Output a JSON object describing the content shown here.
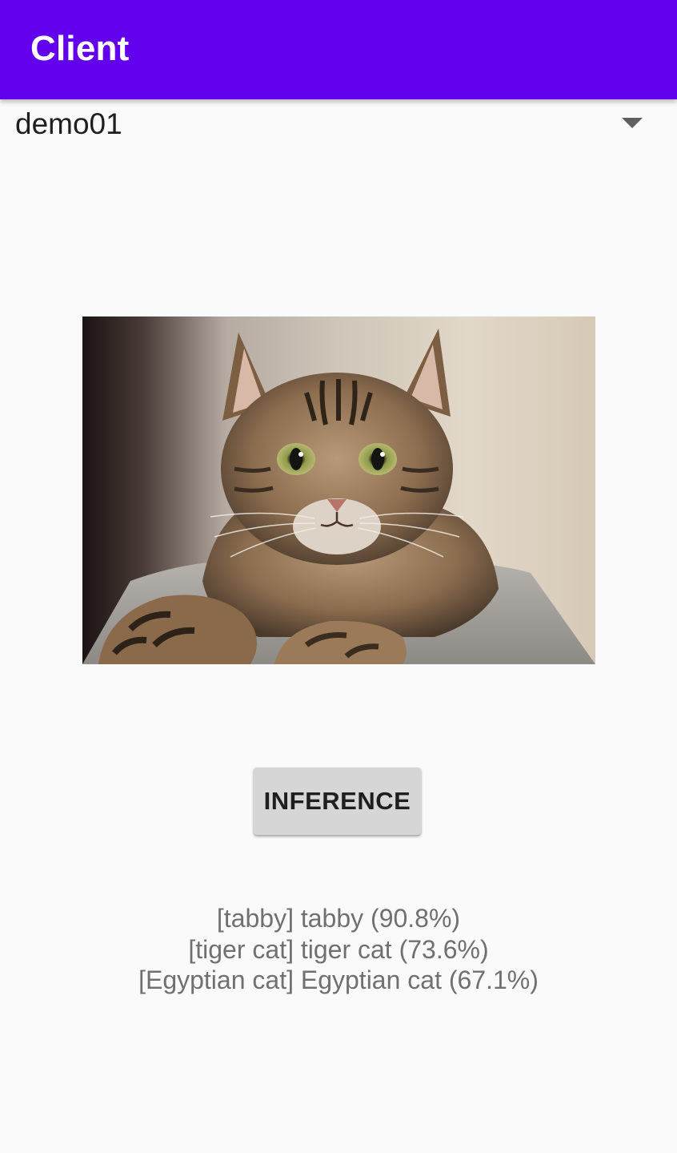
{
  "app_bar": {
    "title": "Client",
    "background_color": "#6200ee"
  },
  "model_selector": {
    "selected_value": "demo01",
    "icon": "dropdown-arrow-icon"
  },
  "image_preview": {
    "subject": "tabby cat photo"
  },
  "actions": {
    "inference_label": "INFERENCE"
  },
  "results": [
    "[tabby] tabby (90.8%)",
    "[tiger cat] tiger cat (73.6%)",
    "[Egyptian cat] Egyptian cat (67.1%)"
  ]
}
